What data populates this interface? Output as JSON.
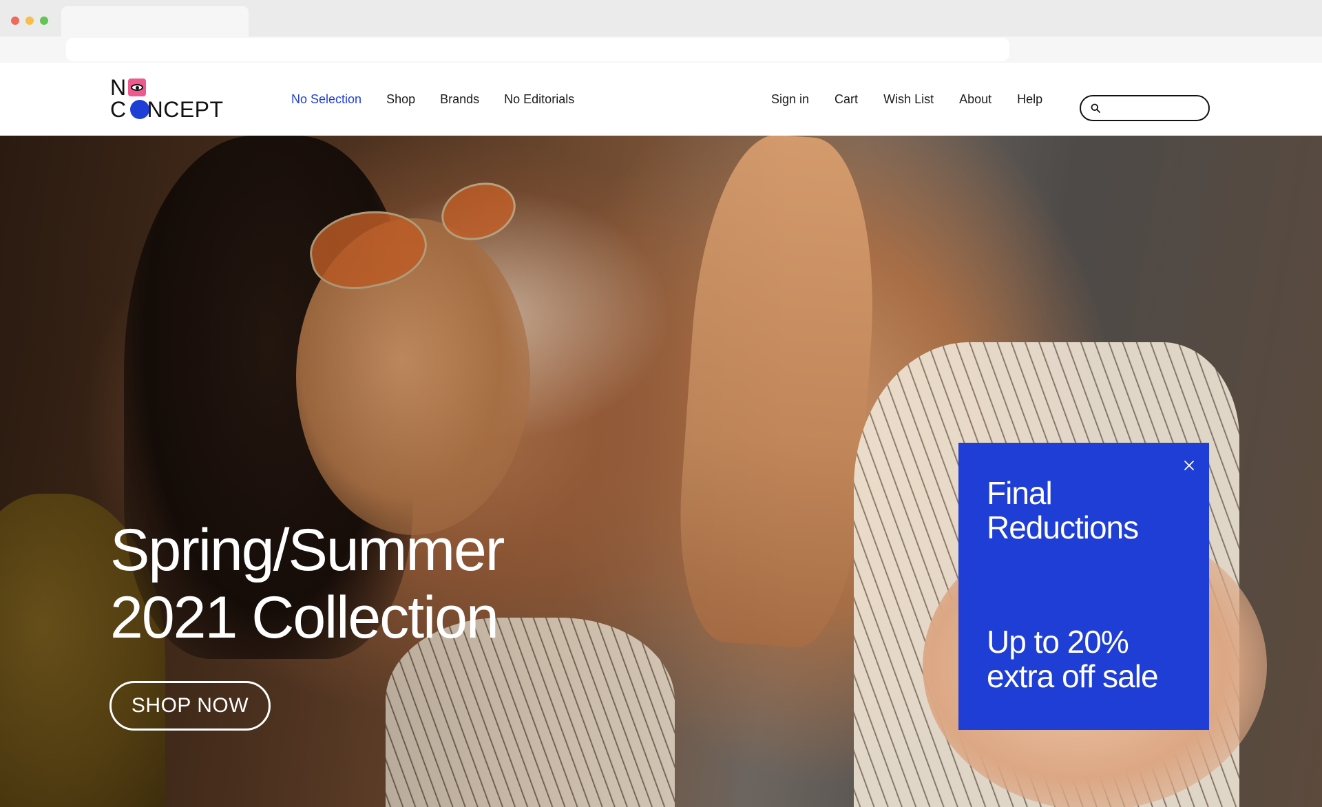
{
  "header": {
    "logo": {
      "line1": "NO",
      "line2": "CONCEPT"
    },
    "nav_primary": [
      {
        "label": "No Selection",
        "active": true
      },
      {
        "label": "Shop",
        "active": false
      },
      {
        "label": "Brands",
        "active": false
      },
      {
        "label": "No Editorials",
        "active": false
      }
    ],
    "nav_secondary": [
      {
        "label": "Sign in"
      },
      {
        "label": "Cart"
      },
      {
        "label": "Wish List"
      },
      {
        "label": "About"
      },
      {
        "label": "Help"
      }
    ],
    "search": {
      "value": "",
      "placeholder": ""
    }
  },
  "hero": {
    "title_line1": "Spring/Summer",
    "title_line2": "2021 Collection",
    "cta_label": "SHOP NOW"
  },
  "promo": {
    "title_line1": "Final",
    "title_line2": "Reductions",
    "offer_line1": "Up to 20%",
    "offer_line2": "extra off sale"
  },
  "colors": {
    "accent": "#1f3ed6",
    "logo_pink": "#ee5a8f",
    "text": "#1a1a1a",
    "white": "#ffffff"
  },
  "icons": {
    "search": "search-icon",
    "close": "close-icon",
    "logo_eye": "eye-icon"
  }
}
